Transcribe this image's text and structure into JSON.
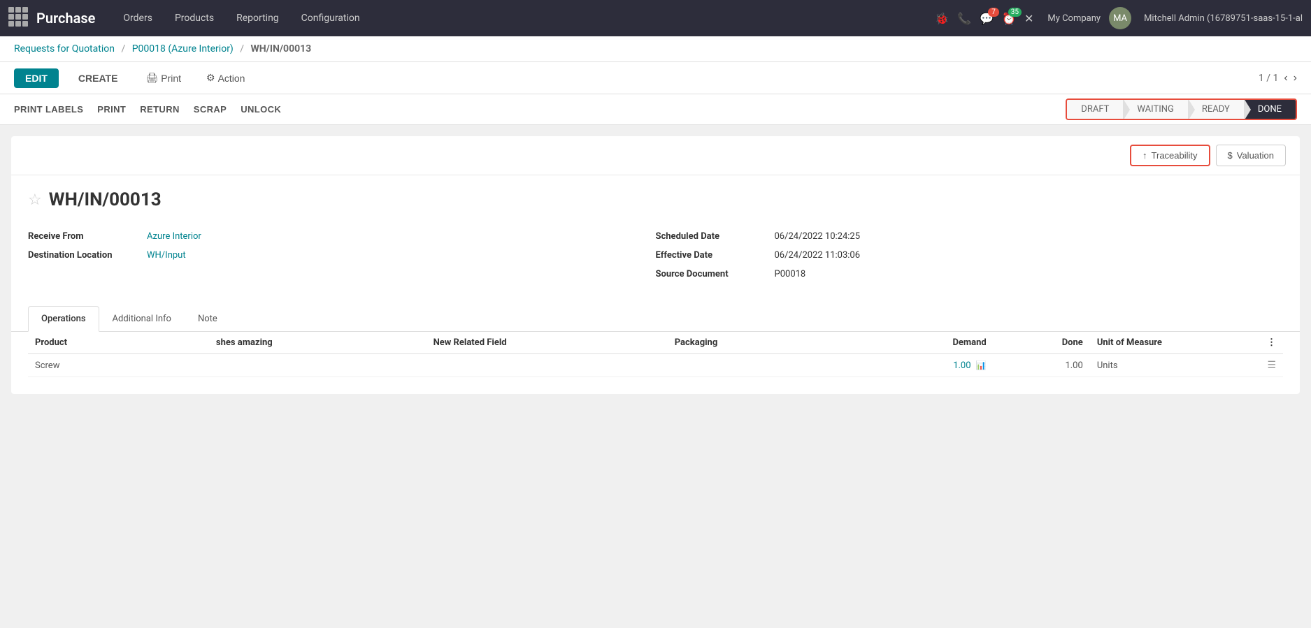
{
  "topnav": {
    "brand": "Purchase",
    "menu": [
      "Orders",
      "Products",
      "Reporting",
      "Configuration"
    ],
    "company": "My Company",
    "user": "Mitchell Admin (16789751-saas-15-1-al",
    "badges": {
      "messages": "7",
      "activity": "35"
    }
  },
  "breadcrumb": {
    "parts": [
      "Requests for Quotation",
      "P00018 (Azure Interior)",
      "WH/IN/00013"
    ],
    "separators": [
      "/",
      "/"
    ]
  },
  "actionbar": {
    "edit_label": "EDIT",
    "create_label": "CREATE",
    "print_label": "Print",
    "action_label": "Action",
    "pagination": "1 / 1"
  },
  "secondarybar": {
    "buttons": [
      "PRINT LABELS",
      "PRINT",
      "RETURN",
      "SCRAP",
      "UNLOCK"
    ]
  },
  "status_pipeline": {
    "steps": [
      "DRAFT",
      "WAITING",
      "READY",
      "DONE"
    ],
    "active": "DONE"
  },
  "top_action_buttons": {
    "traceability": "Traceability",
    "valuation": "Valuation"
  },
  "record": {
    "title": "WH/IN/00013",
    "fields_left": [
      {
        "label": "Receive From",
        "value": "Azure Interior",
        "link": true
      },
      {
        "label": "Destination Location",
        "value": "WH/Input",
        "link": true
      }
    ],
    "fields_right": [
      {
        "label": "Scheduled Date",
        "value": "06/24/2022 10:24:25",
        "link": false
      },
      {
        "label": "Effective Date",
        "value": "06/24/2022 11:03:06",
        "link": false
      },
      {
        "label": "Source Document",
        "value": "P00018",
        "link": false
      }
    ]
  },
  "tabs": [
    {
      "label": "Operations",
      "active": true
    },
    {
      "label": "Additional Info",
      "active": false
    },
    {
      "label": "Note",
      "active": false
    }
  ],
  "table": {
    "columns": [
      "Product",
      "shes amazing",
      "New Related Field",
      "Packaging",
      "Demand",
      "Done",
      "Unit of Measure",
      ""
    ],
    "rows": [
      {
        "product": "Screw",
        "shes_amazing": "",
        "new_related_field": "",
        "packaging": "",
        "demand": "1.00",
        "done": "1.00",
        "uom": "Units"
      }
    ]
  }
}
